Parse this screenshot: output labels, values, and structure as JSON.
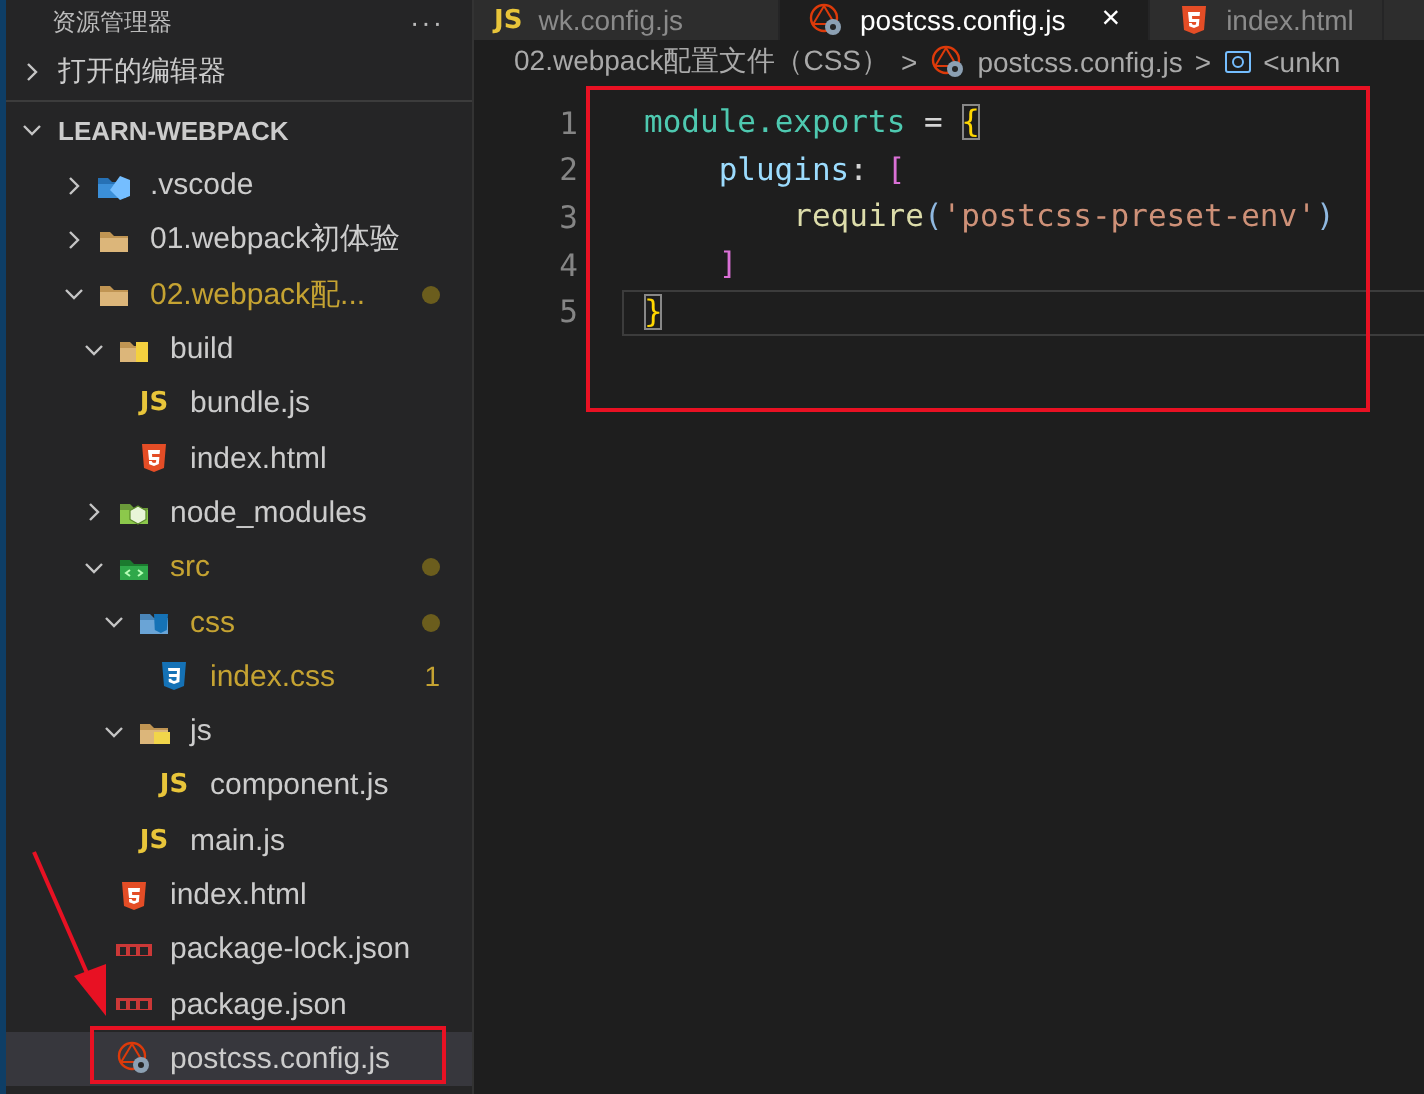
{
  "sidebar": {
    "title": "资源管理器",
    "more": "···",
    "sections": [
      {
        "label": "打开的编辑器",
        "expanded": false
      },
      {
        "label": "LEARN-WEBPACK",
        "expanded": true
      }
    ],
    "tree": [
      {
        "name": ".vscode",
        "kind": "vscode-folder",
        "expanded": false,
        "modified": false,
        "dot": false,
        "selected": false
      },
      {
        "name": "01.webpack初体验",
        "kind": "folder",
        "expanded": false,
        "modified": false,
        "dot": false,
        "selected": false
      },
      {
        "name": "02.webpack配...",
        "kind": "folder",
        "expanded": true,
        "modified": true,
        "dot": true,
        "selected": false,
        "children": [
          {
            "name": "build",
            "kind": "build-folder",
            "expanded": true,
            "modified": false,
            "dot": false,
            "selected": false,
            "children": [
              {
                "name": "bundle.js",
                "kind": "js",
                "icon_label": "JS",
                "modified": false,
                "dot": false,
                "selected": false
              },
              {
                "name": "index.html",
                "kind": "html",
                "modified": false,
                "dot": false,
                "selected": false
              }
            ]
          },
          {
            "name": "node_modules",
            "kind": "node-folder",
            "expanded": false,
            "modified": false,
            "dot": false,
            "selected": false
          },
          {
            "name": "src",
            "kind": "src-folder",
            "expanded": true,
            "modified": true,
            "dot": true,
            "selected": false,
            "children": [
              {
                "name": "css",
                "kind": "css-folder",
                "expanded": true,
                "modified": true,
                "dot": true,
                "selected": false,
                "children": [
                  {
                    "name": "index.css",
                    "kind": "css",
                    "modified": true,
                    "dot": false,
                    "badge": "1",
                    "selected": false
                  }
                ]
              },
              {
                "name": "js",
                "kind": "js-folder",
                "expanded": true,
                "modified": false,
                "dot": false,
                "selected": false,
                "children": [
                  {
                    "name": "component.js",
                    "kind": "js",
                    "icon_label": "JS",
                    "modified": false,
                    "dot": false,
                    "selected": false
                  }
                ]
              },
              {
                "name": "main.js",
                "kind": "js",
                "icon_label": "JS",
                "modified": false,
                "dot": false,
                "selected": false
              }
            ]
          },
          {
            "name": "index.html",
            "kind": "html",
            "modified": false,
            "dot": false,
            "selected": false
          },
          {
            "name": "package-lock.json",
            "kind": "npm",
            "modified": false,
            "dot": false,
            "selected": false
          },
          {
            "name": "package.json",
            "kind": "npm",
            "modified": false,
            "dot": false,
            "selected": false
          },
          {
            "name": "postcss.config.js",
            "kind": "postcss",
            "modified": false,
            "dot": false,
            "selected": true
          }
        ]
      }
    ]
  },
  "tabs": [
    {
      "label": "wk.config.js",
      "kind": "js",
      "icon_label": "JS",
      "selected": false
    },
    {
      "label": "postcss.config.js",
      "kind": "postcss",
      "selected": true,
      "close": "×"
    },
    {
      "label": "index.html",
      "kind": "html",
      "selected": false
    }
  ],
  "breadcrumb": [
    {
      "text": "02.webpack配置文件（CSS）",
      "kind": "folder-name"
    },
    {
      "text": ">",
      "kind": "separator"
    },
    {
      "text": "postcss.config.js",
      "kind": "postcss"
    },
    {
      "text": ">",
      "kind": "separator"
    },
    {
      "text": "<unkn",
      "kind": "symbol"
    }
  ],
  "code": [
    {
      "number": "1",
      "kind": "top",
      "current": false,
      "tokens": [
        {
          "text": "module.exports",
          "kind": "type"
        },
        {
          "text": " = ",
          "kind": "plain"
        },
        {
          "text": "{",
          "kind": "brace-match"
        }
      ]
    },
    {
      "number": "2",
      "kind": "nested",
      "current": false,
      "tokens": [
        {
          "text": "plugins",
          "kind": "property"
        },
        {
          "text": ": ",
          "kind": "plain"
        },
        {
          "text": "[",
          "kind": "bracket"
        }
      ]
    },
    {
      "number": "3",
      "kind": "deep",
      "current": false,
      "tokens": [
        {
          "text": "require",
          "kind": "function"
        },
        {
          "text": "(",
          "kind": "paren"
        },
        {
          "text": "'postcss-preset-env'",
          "kind": "string"
        },
        {
          "text": ")",
          "kind": "paren"
        }
      ]
    },
    {
      "number": "4",
      "kind": "nested",
      "current": false,
      "tokens": [
        {
          "text": "]",
          "kind": "bracket"
        }
      ]
    },
    {
      "number": "5",
      "kind": "top",
      "current": true,
      "tokens": [
        {
          "text": "}",
          "kind": "brace-match"
        }
      ]
    }
  ]
}
